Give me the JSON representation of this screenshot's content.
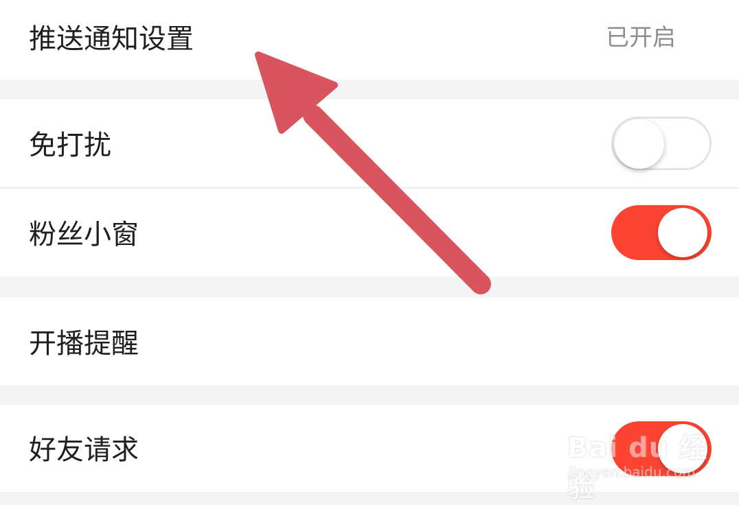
{
  "settings": {
    "push": {
      "label": "推送通知设置",
      "value": "已开启"
    },
    "dnd": {
      "label": "免打扰",
      "state": "off"
    },
    "fan_window": {
      "label": "粉丝小窗",
      "state": "on"
    },
    "live_reminder": {
      "label": "开播提醒"
    },
    "friend_request": {
      "label": "好友请求",
      "state": "on"
    }
  },
  "colors": {
    "toggle_on": "#fd4433",
    "arrow": "#d8555e",
    "section_gap": "#f4f4f4"
  },
  "watermark": {
    "main": "Bai du 经验",
    "sub": "jingyan.baidu.com"
  },
  "annotation": {
    "icon": "arrow-up-left-icon"
  }
}
